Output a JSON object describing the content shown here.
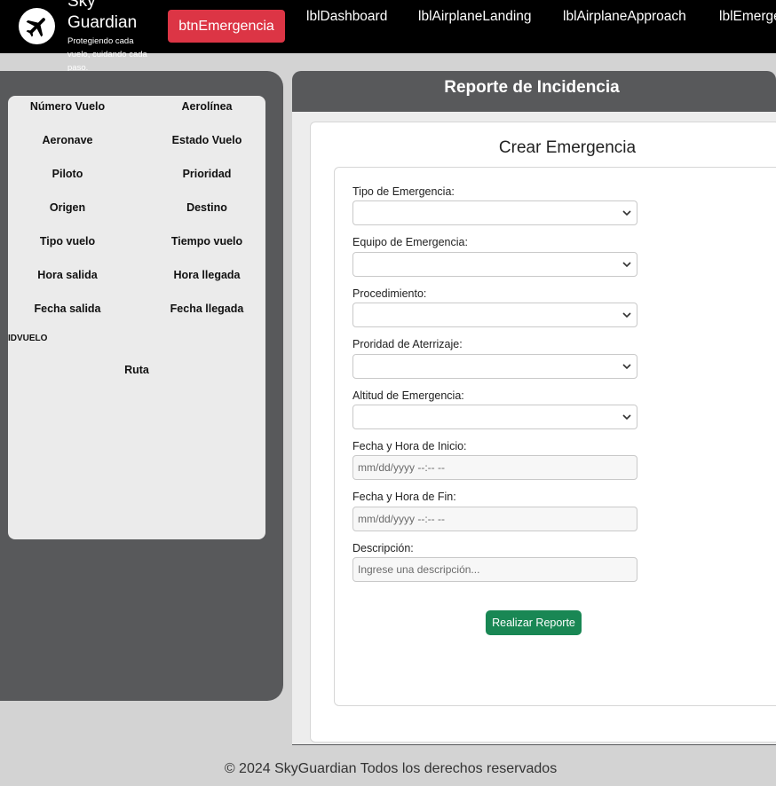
{
  "header": {
    "brand": "Sky Guardian",
    "tagline": "Protegiendo cada vuelo, cuidando cada paso.",
    "emergency_button": "btnEmergencia",
    "nav": [
      "lblDashboard",
      "lblAirplaneLanding",
      "lblAirplaneApproach",
      "lblEmergency"
    ],
    "logo_icon": "airplane-icon"
  },
  "flight_info": {
    "labels": [
      [
        "Número Vuelo",
        "Aerolínea"
      ],
      [
        "Aeronave",
        "Estado Vuelo"
      ],
      [
        "Piloto",
        "Prioridad"
      ],
      [
        "Origen",
        "Destino"
      ],
      [
        "Tipo vuelo",
        "Tiempo vuelo"
      ],
      [
        "Hora salida",
        "Hora llegada"
      ],
      [
        "Fecha salida",
        "Fecha llegada"
      ]
    ],
    "id_label": "IDVUELO",
    "route_label": "Ruta"
  },
  "report": {
    "title": "Reporte de Incidencia",
    "form_title": "Crear Emergencia",
    "fields": [
      {
        "label": "Tipo de Emergencia:",
        "type": "select",
        "value": ""
      },
      {
        "label": "Equipo de Emergencia:",
        "type": "select",
        "value": ""
      },
      {
        "label": "Procedimiento:",
        "type": "select",
        "value": ""
      },
      {
        "label": "Proridad de Aterrizaje:",
        "type": "select",
        "value": ""
      },
      {
        "label": "Altitud de Emergencia:",
        "type": "select",
        "value": ""
      },
      {
        "label": "Fecha y Hora de Inicio:",
        "type": "datetime",
        "placeholder": "mm/dd/yyyy --:-- --"
      },
      {
        "label": "Fecha y Hora de Fin:",
        "type": "datetime",
        "placeholder": "mm/dd/yyyy --:-- --"
      },
      {
        "label": "Descripción:",
        "type": "text",
        "placeholder": "Ingrese una descripción..."
      }
    ],
    "submit_label": "Realizar Reporte"
  },
  "footer": "© 2024 SkyGuardian Todos los derechos reservados",
  "colors": {
    "navbar": "#000000",
    "danger": "#dc3545",
    "success": "#198754",
    "panel": "#58595b",
    "background": "#d3d3d3"
  }
}
